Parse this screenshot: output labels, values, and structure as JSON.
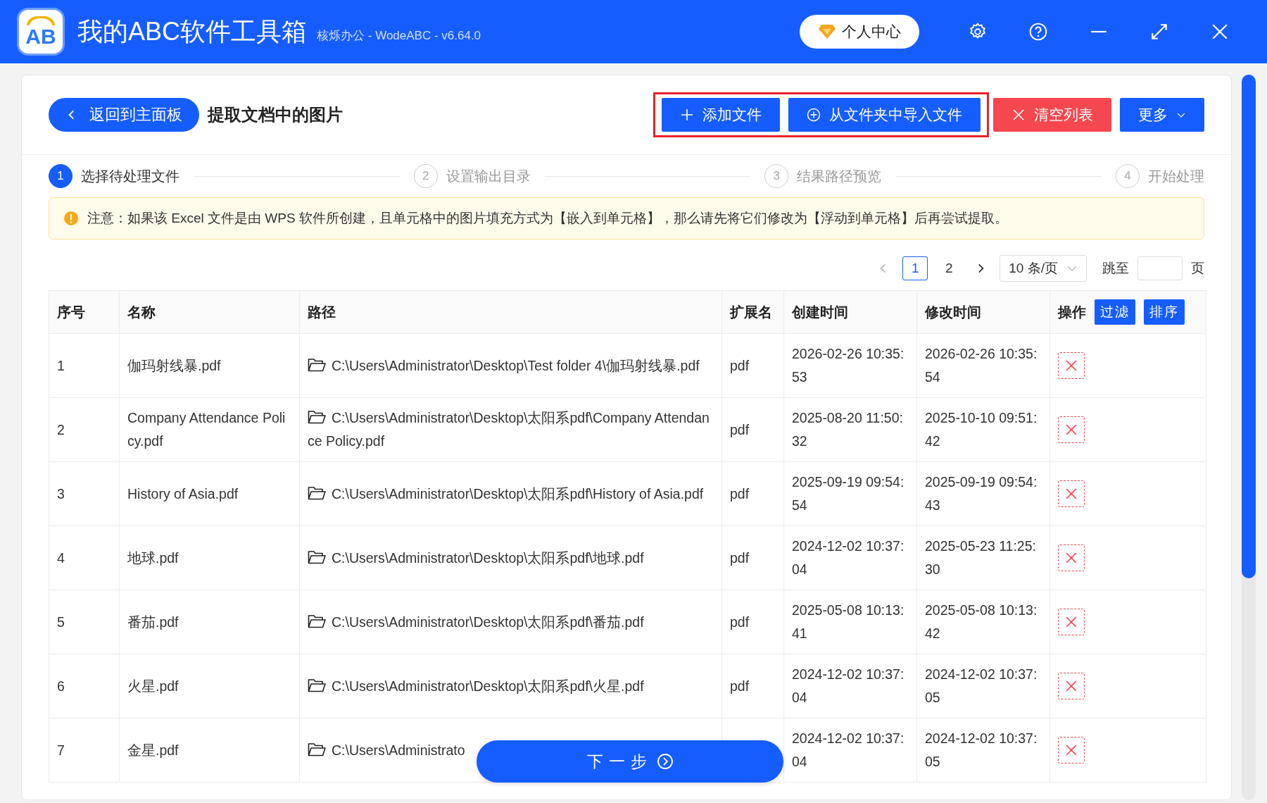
{
  "window": {
    "logo": "AB",
    "title": "我的ABC软件工具箱",
    "subtitle": "核烁办公 - WodeABC - v6.64.0",
    "account_button": "个人中心"
  },
  "header": {
    "back_button": "返回到主面板",
    "page_title": "提取文档中的图片",
    "highlighted_buttons": [
      {
        "label": "添加文件",
        "kind": "add"
      },
      {
        "label": "从文件夹中导入文件",
        "kind": "import"
      }
    ],
    "buttons": [
      {
        "label": "清空列表",
        "kind": "clear"
      },
      {
        "label": "更多",
        "kind": "more"
      }
    ]
  },
  "steps": [
    {
      "number": "1",
      "label": "选择待处理文件",
      "selected": true
    },
    {
      "number": "2",
      "label": "设置输出目录",
      "selected": false
    },
    {
      "number": "3",
      "label": "结果路径预览",
      "selected": false
    },
    {
      "number": "4",
      "label": "开始处理",
      "selected": false
    }
  ],
  "notice": "注意：如果该 Excel 文件是由 WPS 软件所创建，且单元格中的图片填充方式为【嵌入到单元格】，那么请先将它们修改为【浮动到单元格】后再尝试提取。",
  "pagination": {
    "prev_disabled": true,
    "pages": [
      {
        "label": "1",
        "selected": true
      },
      {
        "label": "2",
        "selected": false
      }
    ],
    "page_size": "10 条/页",
    "jump_label": "跳至",
    "page_unit": "页"
  },
  "table": {
    "columns": [
      "序号",
      "名称",
      "路径",
      "扩展名",
      "创建时间",
      "修改时间",
      "操作"
    ],
    "header_buttons": [
      "过滤",
      "排序"
    ],
    "rows": [
      {
        "index": "1",
        "name": "伽玛射线暴.pdf",
        "path": "C:\\Users\\Administrator\\Desktop\\Test folder 4\\伽玛射线暴.pdf",
        "extension": "pdf",
        "created": "2026-02-26 10:35:53",
        "modified": "2026-02-26 10:35:54"
      },
      {
        "index": "2",
        "name": "Company Attendance Policy.pdf",
        "path": "C:\\Users\\Administrator\\Desktop\\太阳系pdf\\Company Attendance Policy.pdf",
        "extension": "pdf",
        "created": "2025-08-20 11:50:32",
        "modified": "2025-10-10 09:51:42"
      },
      {
        "index": "3",
        "name": "History of Asia.pdf",
        "path": "C:\\Users\\Administrator\\Desktop\\太阳系pdf\\History of Asia.pdf",
        "extension": "pdf",
        "created": "2025-09-19 09:54:54",
        "modified": "2025-09-19 09:54:43"
      },
      {
        "index": "4",
        "name": "地球.pdf",
        "path": "C:\\Users\\Administrator\\Desktop\\太阳系pdf\\地球.pdf",
        "extension": "pdf",
        "created": "2024-12-02 10:37:04",
        "modified": "2025-05-23 11:25:30"
      },
      {
        "index": "5",
        "name": "番茄.pdf",
        "path": "C:\\Users\\Administrator\\Desktop\\太阳系pdf\\番茄.pdf",
        "extension": "pdf",
        "created": "2025-05-08 10:13:41",
        "modified": "2025-05-08 10:13:42"
      },
      {
        "index": "6",
        "name": "火星.pdf",
        "path": "C:\\Users\\Administrator\\Desktop\\太阳系pdf\\火星.pdf",
        "extension": "pdf",
        "created": "2024-12-02 10:37:04",
        "modified": "2024-12-02 10:37:05"
      },
      {
        "index": "7",
        "name": "金星.pdf",
        "path": "C:\\Users\\Administrato",
        "created": "2024-12-02 10:37:04",
        "modified": "2024-12-02 10:37:05"
      }
    ]
  },
  "next_button": "下一步"
}
